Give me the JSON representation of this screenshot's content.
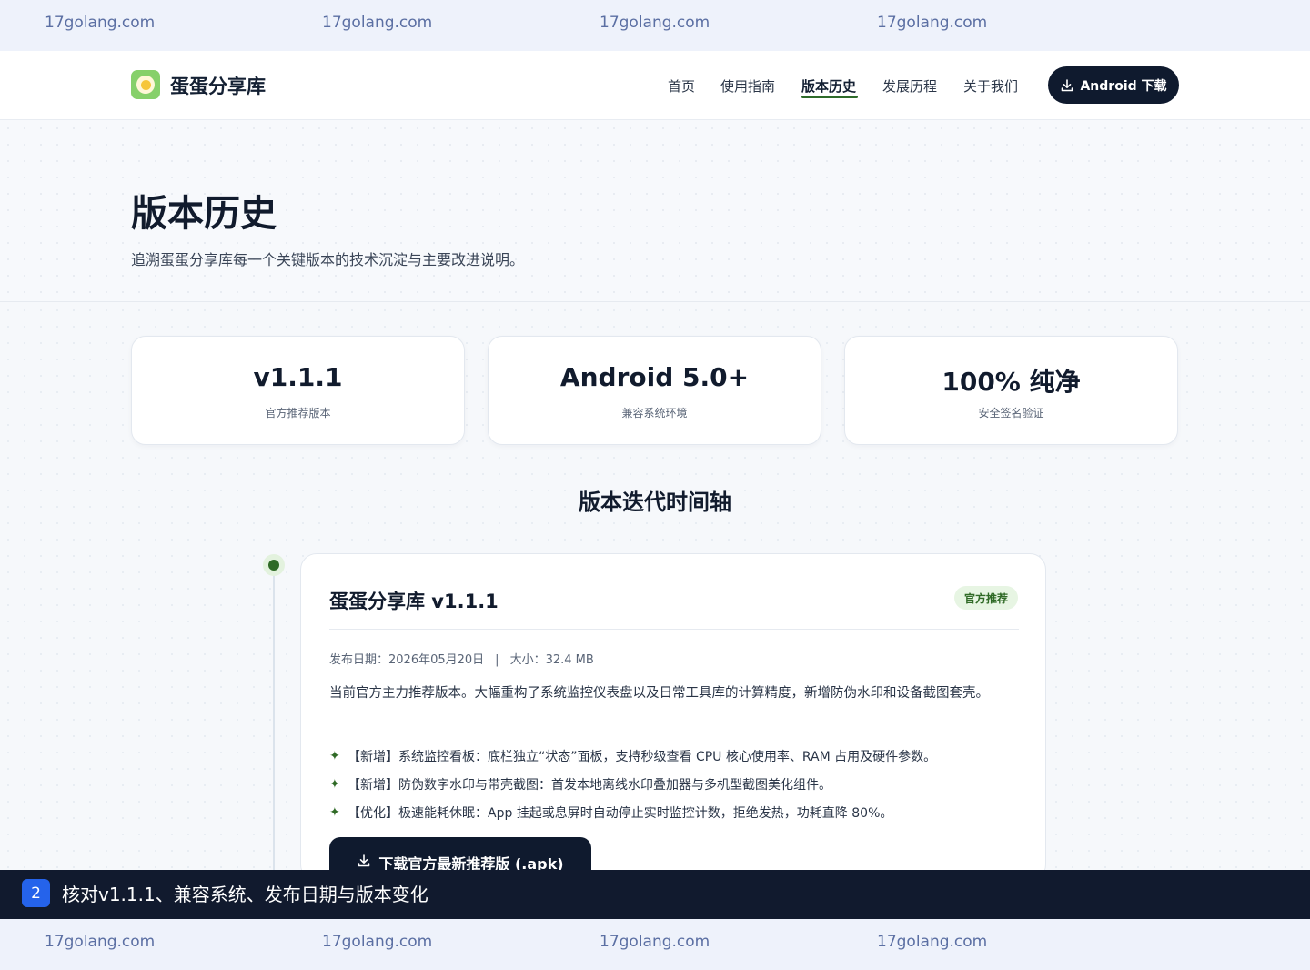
{
  "watermark": {
    "text": "17golang.com"
  },
  "header": {
    "brand": "蛋蛋分享库",
    "nav": [
      "首页",
      "使用指南",
      "版本历史",
      "发展历程",
      "关于我们"
    ],
    "active_nav": "版本历史",
    "cta_label": "Android 下载"
  },
  "hero": {
    "title": "版本历史",
    "subtitle": "追溯蛋蛋分享库每一个关键版本的技术沉淀与主要改进说明。"
  },
  "stats": [
    {
      "value": "v1.1.1",
      "label": "官方推荐版本"
    },
    {
      "value": "Android 5.0+",
      "label": "兼容系统环境"
    },
    {
      "value": "100% 纯净",
      "label": "安全签名验证"
    }
  ],
  "timeline": {
    "section_title": "版本迭代时间轴",
    "release": {
      "title": "蛋蛋分享库 v1.1.1",
      "badge": "官方推荐",
      "date": "发布日期：2026年05月20日",
      "separator": "|",
      "size": "大小：32.4 MB",
      "description": "当前官方主力推荐版本。大幅重构了系统监控仪表盘以及日常工具库的计算精度，新增防伪水印和设备截图套壳。",
      "features": [
        "【新增】系统监控看板：底栏独立“状态”面板，支持秒级查看 CPU 核心使用率、RAM 占用及硬件参数。",
        "【新增】防伪数字水印与带壳截图：首发本地离线水印叠加器与多机型截图美化组件。",
        "【优化】极速能耗休眠：App 挂起或息屏时自动停止实时监控计数，拒绝发热，功耗直降 80%。"
      ],
      "feature_bullet": "✦",
      "download_label": "下载官方最新推荐版 (.apk)"
    }
  },
  "caption": {
    "step": "2",
    "text": "核对v1.1.1、兼容系统、发布日期与版本变化"
  },
  "colors": {
    "accent_green": "#2f6a26",
    "dark_navy": "#0f1a2e",
    "caption_blue": "#2563eb"
  }
}
